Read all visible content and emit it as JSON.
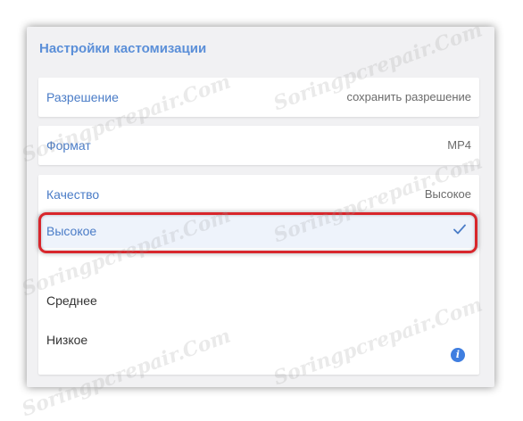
{
  "panel": {
    "title": "Настройки кастомизации"
  },
  "settings": [
    {
      "label": "Разрешение",
      "value": "сохранить разрешение"
    },
    {
      "label": "Формат",
      "value": "MP4"
    }
  ],
  "quality": {
    "label": "Качество",
    "value": "Высокое",
    "options": [
      {
        "label": "Высокое",
        "selected": true
      },
      {
        "label": "Среднее",
        "selected": false
      },
      {
        "label": "Низкое",
        "selected": false
      }
    ]
  },
  "icons": {
    "check": "check-icon",
    "info": "info-icon"
  },
  "colors": {
    "accent": "#4a7cc7",
    "highlight": "#d8262c"
  },
  "watermark": "Soringpcrepair.Com"
}
